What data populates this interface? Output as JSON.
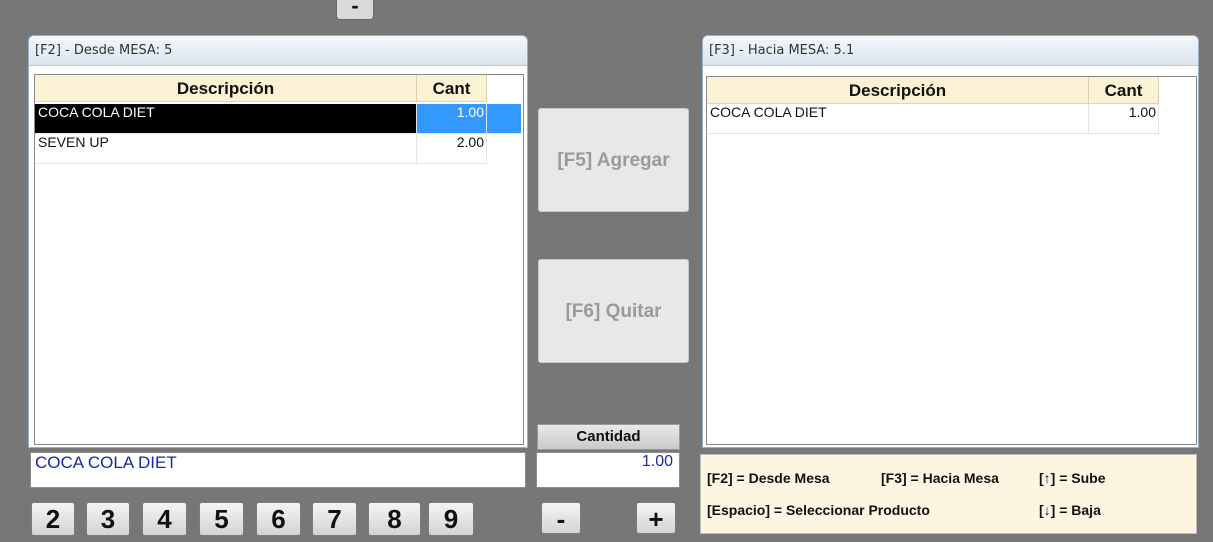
{
  "top_button": {
    "label": "-"
  },
  "left_panel": {
    "title": "[F2] - Desde MESA: 5",
    "columns": {
      "desc": "Descripción",
      "qty": "Cant"
    },
    "rows": [
      {
        "desc": "COCA COLA DIET",
        "qty": "1.00"
      },
      {
        "desc": "SEVEN UP",
        "qty": "2.00"
      }
    ]
  },
  "right_panel": {
    "title": "[F3] - Hacia MESA: 5.1",
    "columns": {
      "desc": "Descripción",
      "qty": "Cant"
    },
    "rows": [
      {
        "desc": "COCA COLA DIET",
        "qty": "1.00"
      }
    ]
  },
  "actions": {
    "add": "[F5] Agregar",
    "remove": "[F6] Quitar"
  },
  "quantity": {
    "label": "Cantidad",
    "value": "1.00",
    "minus": "-",
    "plus": "+"
  },
  "selected_product": "COCA COLA DIET",
  "tables": [
    "2",
    "3",
    "4",
    "5",
    "6",
    "7",
    "8",
    "9"
  ],
  "help": {
    "f2": "[F2] = Desde Mesa",
    "f3": "[F3] = Hacia Mesa",
    "up": "[↑] = Sube",
    "space": "[Espacio] = Seleccionar Producto",
    "down": "[↓] = Baja"
  }
}
